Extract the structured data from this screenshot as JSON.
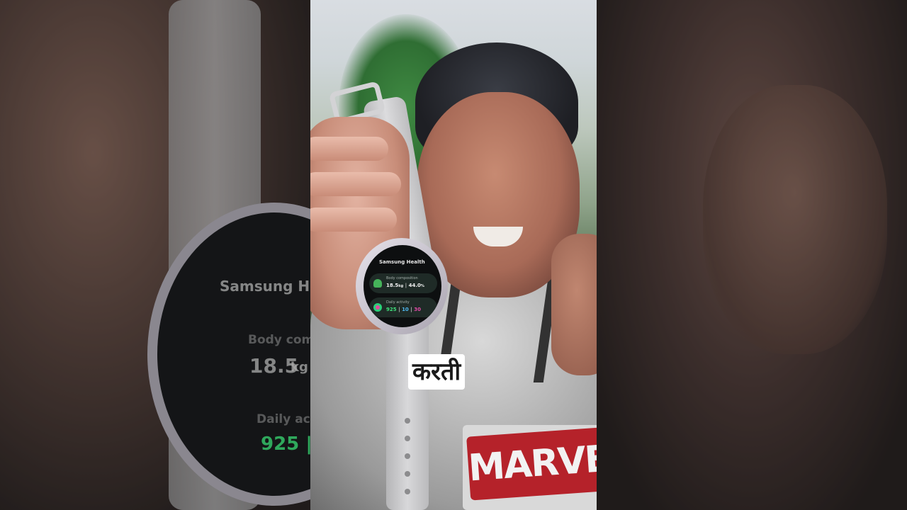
{
  "watch_screen": {
    "app_title": "Samsung Health",
    "body_composition": {
      "label": "Body composition",
      "value_1": "18.5",
      "unit_1": "kg",
      "separator": "|",
      "value_2": "44.0",
      "unit_2": "%"
    },
    "daily_activity": {
      "label": "Daily activity",
      "steps": "925",
      "separator": "|",
      "minutes": "10",
      "calories": "30"
    }
  },
  "blurred_left_panel": {
    "title_fragment": "Samsung H",
    "label_fragment": "Body com",
    "value_fragment": "18.5",
    "unit_fragment": "kg",
    "label2_fragment": "Daily ac",
    "value2_fragment": "925 |"
  },
  "shirt_logo": "MARVE",
  "subtitle": "करती",
  "colors": {
    "steps_green": "#3fe07b",
    "minutes_blue": "#4fb7f0",
    "calories_pink": "#e24aa7",
    "shirt_logo_red": "#b5222a"
  }
}
